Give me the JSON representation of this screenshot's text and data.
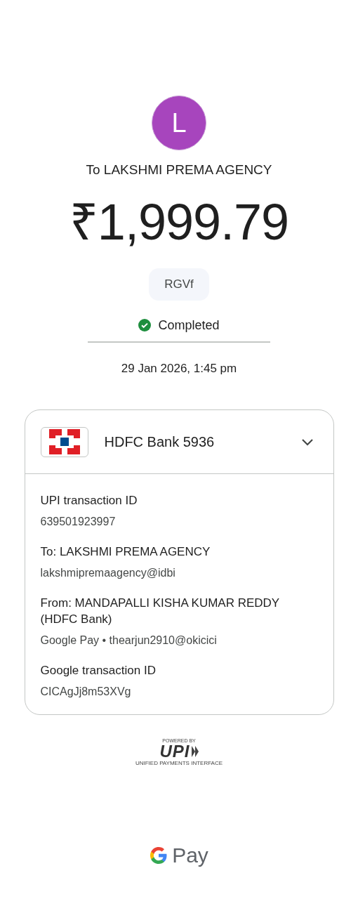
{
  "payee": {
    "initial": "L",
    "title": "To LAKSHMI PREMA AGENCY"
  },
  "amount": "₹1,999.79",
  "note": "RGVf",
  "status": {
    "kind": "completed",
    "label": "Completed"
  },
  "datetime": "29 Jan 2026, 1:45 pm",
  "account": {
    "name": "HDFC Bank 5936",
    "expanded": true
  },
  "details": [
    {
      "label": "UPI transaction ID",
      "value": "639501923997"
    },
    {
      "label": "To: LAKSHMI PREMA AGENCY",
      "value": "lakshmipremaagency@idbi"
    },
    {
      "label": "From: MANDAPALLI KISHA KUMAR REDDY (HDFC Bank)",
      "value": "Google Pay • thearjun2910@okicici"
    },
    {
      "label": "Google transaction ID",
      "value": "CICAgJj8m53XVg"
    }
  ],
  "upi_logo": {
    "caption": "POWERED BY",
    "mark": "UPI",
    "tagline": "UNIFIED PAYMENTS INTERFACE"
  },
  "footer_brand": "Pay"
}
